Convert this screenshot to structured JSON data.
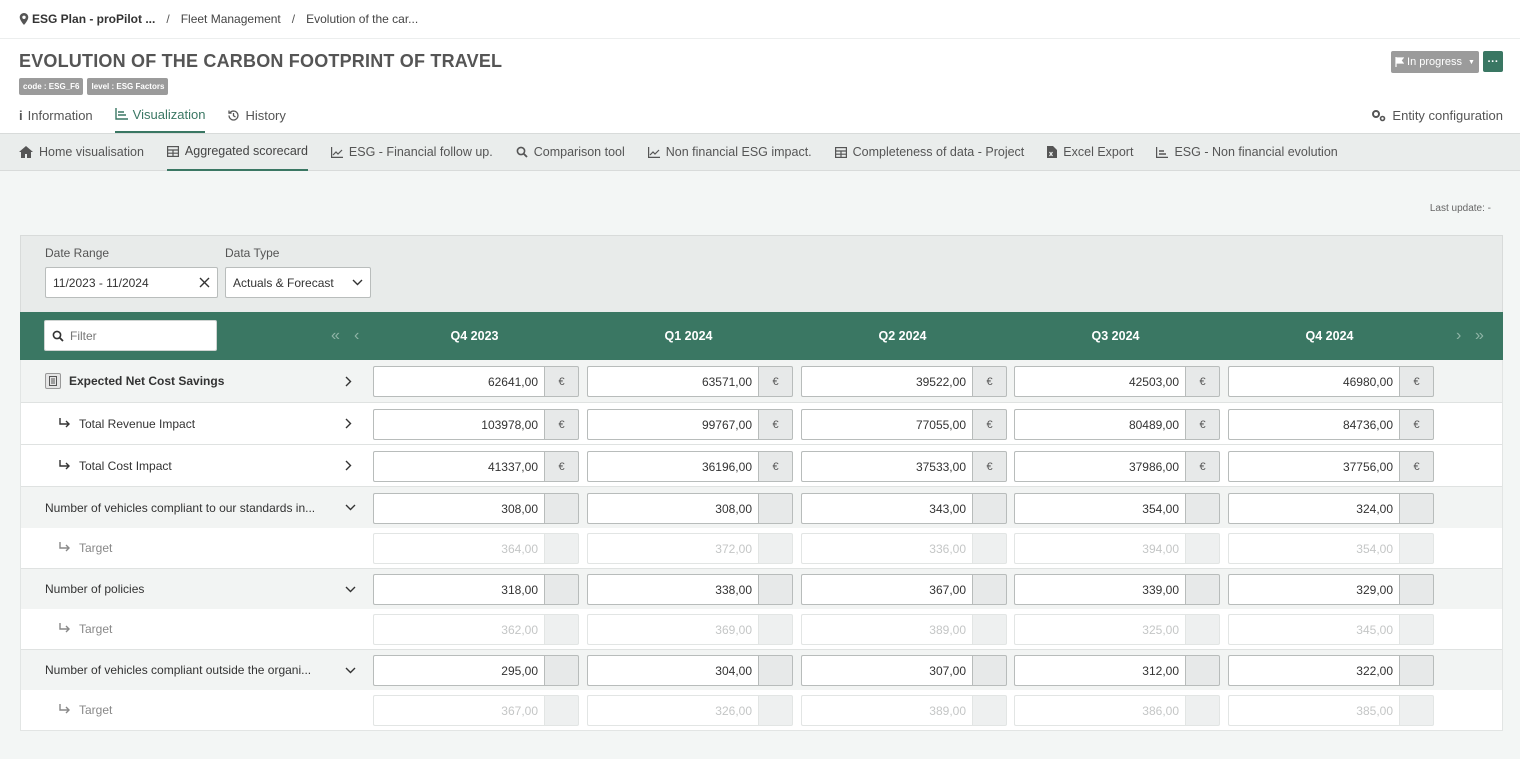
{
  "breadcrumb": {
    "items": [
      "ESG Plan - proPilot ...",
      "Fleet Management",
      "Evolution of the car..."
    ],
    "separator": "/"
  },
  "title": "EVOLUTION OF THE CARBON FOOTPRINT OF TRAVEL",
  "tags": [
    "code : ESG_F6",
    "level : ESG Factors"
  ],
  "status": {
    "label": "In progress",
    "color": "#9b9b9b"
  },
  "more_label": "···",
  "main_tabs": [
    {
      "label": "Information",
      "icon": "info-icon"
    },
    {
      "label": "Visualization",
      "icon": "chart-icon",
      "active": true
    },
    {
      "label": "History",
      "icon": "history-icon"
    }
  ],
  "entity_config": "Entity configuration",
  "sub_tabs": [
    {
      "label": "Home visualisation",
      "icon": "home-icon"
    },
    {
      "label": "Aggregated scorecard",
      "icon": "table-icon",
      "active": true
    },
    {
      "label": "ESG - Financial follow up.",
      "icon": "line-chart-icon"
    },
    {
      "label": "Comparison tool",
      "icon": "search-icon"
    },
    {
      "label": "Non financial ESG impact.",
      "icon": "line-chart-icon"
    },
    {
      "label": "Completeness of data - Project",
      "icon": "table-icon"
    },
    {
      "label": "Excel Export",
      "icon": "file-excel-icon"
    },
    {
      "label": "ESG - Non financial evolution",
      "icon": "bar-chart-icon"
    }
  ],
  "last_update": "Last update: -",
  "filters": {
    "date_range_label": "Date Range",
    "date_range_value": "11/2023 - 11/2024",
    "data_type_label": "Data Type",
    "data_type_value": "Actuals & Forecast"
  },
  "grid": {
    "filter_placeholder": "Filter",
    "periods": [
      "Q4 2023",
      "Q1 2024",
      "Q2 2024",
      "Q3 2024",
      "Q4 2024"
    ],
    "accent": "#3a7763",
    "rows": [
      {
        "label": "Expected Net Cost Savings",
        "kind": "main",
        "unit": "€",
        "values": [
          "62641,00",
          "63571,00",
          "39522,00",
          "42503,00",
          "46980,00"
        ]
      },
      {
        "label": "Total Revenue Impact",
        "kind": "sub",
        "unit": "€",
        "values": [
          "103978,00",
          "99767,00",
          "77055,00",
          "80489,00",
          "84736,00"
        ]
      },
      {
        "label": "Total Cost Impact",
        "kind": "sub",
        "unit": "€",
        "values": [
          "41337,00",
          "36196,00",
          "37533,00",
          "37986,00",
          "37756,00"
        ]
      },
      {
        "label": "Number of vehicles compliant to our standards in...",
        "kind": "kpi",
        "unit": "",
        "values": [
          "308,00",
          "308,00",
          "343,00",
          "354,00",
          "324,00"
        ]
      },
      {
        "label": "Target",
        "kind": "target",
        "unit": "",
        "values": [
          "364,00",
          "372,00",
          "336,00",
          "394,00",
          "354,00"
        ]
      },
      {
        "label": "Number of policies",
        "kind": "kpi",
        "unit": "",
        "values": [
          "318,00",
          "338,00",
          "367,00",
          "339,00",
          "329,00"
        ]
      },
      {
        "label": "Target",
        "kind": "target",
        "unit": "",
        "values": [
          "362,00",
          "369,00",
          "389,00",
          "325,00",
          "345,00"
        ]
      },
      {
        "label": "Number of vehicles compliant outside the organi...",
        "kind": "kpi",
        "unit": "",
        "values": [
          "295,00",
          "304,00",
          "307,00",
          "312,00",
          "322,00"
        ]
      },
      {
        "label": "Target",
        "kind": "target",
        "unit": "",
        "values": [
          "367,00",
          "326,00",
          "389,00",
          "386,00",
          "385,00"
        ]
      }
    ]
  }
}
